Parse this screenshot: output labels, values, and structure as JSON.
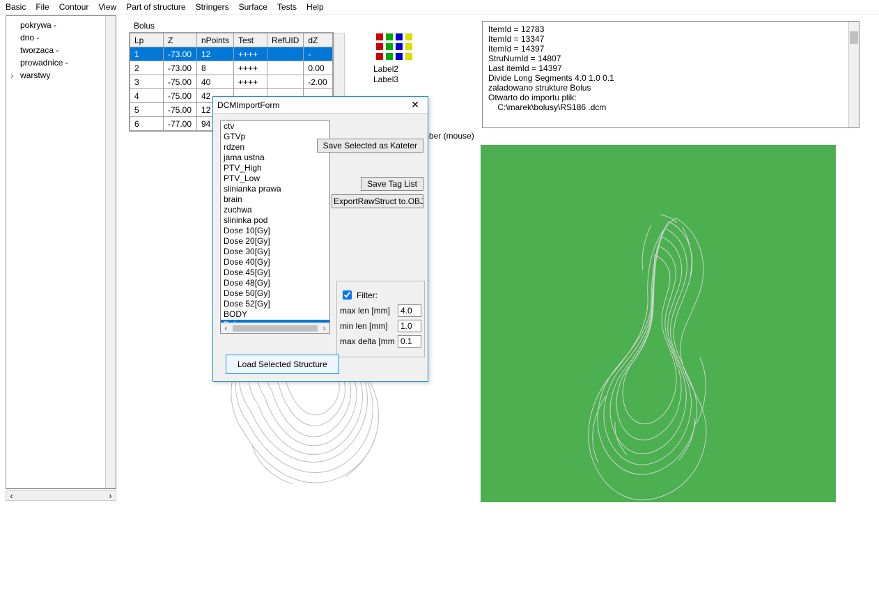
{
  "menu": [
    "Basic",
    "File",
    "Contour",
    "View",
    "Part of structure",
    "Stringers",
    "Surface",
    "Tests",
    "Help"
  ],
  "tree": {
    "items": [
      "pokrywa",
      "dno",
      "tworzaca",
      "prowadnice",
      "warstwy"
    ]
  },
  "grid_title": "Bolus",
  "grid": {
    "headers": {
      "lp": "Lp",
      "z": "Z",
      "np": "nPoints",
      "test": "Test",
      "ref": "RefUID",
      "dz": "dZ"
    },
    "rows": [
      {
        "lp": "1",
        "z": "-73.00",
        "np": "12",
        "test": "++++",
        "ref": "",
        "dz": "-",
        "selected": true
      },
      {
        "lp": "2",
        "z": "-73.00",
        "np": "8",
        "test": "++++",
        "ref": "",
        "dz": "0.00"
      },
      {
        "lp": "3",
        "z": "-75.00",
        "np": "40",
        "test": "++++",
        "ref": "",
        "dz": "-2.00"
      },
      {
        "lp": "4",
        "z": "-75.00",
        "np": "42",
        "test": "",
        "ref": "",
        "dz": ""
      },
      {
        "lp": "5",
        "z": "-75.00",
        "np": "12",
        "test": "",
        "ref": "",
        "dz": ""
      },
      {
        "lp": "6",
        "z": "-77.00",
        "np": "94",
        "test": "",
        "ref": "",
        "dz": ""
      }
    ]
  },
  "swatch_labels": {
    "l2": "Label2",
    "l3": "Label3"
  },
  "mouse_label": "mber (mouse)",
  "log_lines": [
    "ItemId = 12783",
    "ItemId = 13347",
    "ItemId = 14397",
    "StruNumId = 14807",
    "Last itemId = 14397",
    "Divide Long Segments 4.0 1.0 0.1",
    "zaladowano strukture Bolus",
    "Otwarto do importu plik:",
    "    C:\\marek\\bolusy\\RS186 .dcm"
  ],
  "dialog": {
    "title": "DCMImportForm",
    "list": [
      "ctv",
      "GTVp",
      "rdzen",
      "jama ustna",
      "PTV_High",
      "PTV_Low",
      "slinianka prawa",
      "brain",
      "zuchwa",
      "slininka pod",
      "Dose 10[Gy]",
      "Dose 20[Gy]",
      "Dose 30[Gy]",
      "Dose 40[Gy]",
      "Dose 45[Gy]",
      "Dose 48[Gy]",
      "Dose 50[Gy]",
      "Dose 52[Gy]",
      "BODY",
      "Bolus"
    ],
    "selected_index": 19,
    "buttons": {
      "save_kateter": "Save Selected as Kateter",
      "save_tags": "Save Tag List",
      "export_obj": "ExportRawStruct to.OBJ file",
      "load_struct": "Load Selected Structure"
    },
    "filter": {
      "label": "Filter:",
      "maxlen_l": "max len [mm]",
      "maxlen_v": "4.0",
      "minlen_l": "min len [mm]",
      "minlen_v": "1.0",
      "maxdelta_l": "max delta [mm",
      "maxdelta_v": "0.1"
    }
  }
}
